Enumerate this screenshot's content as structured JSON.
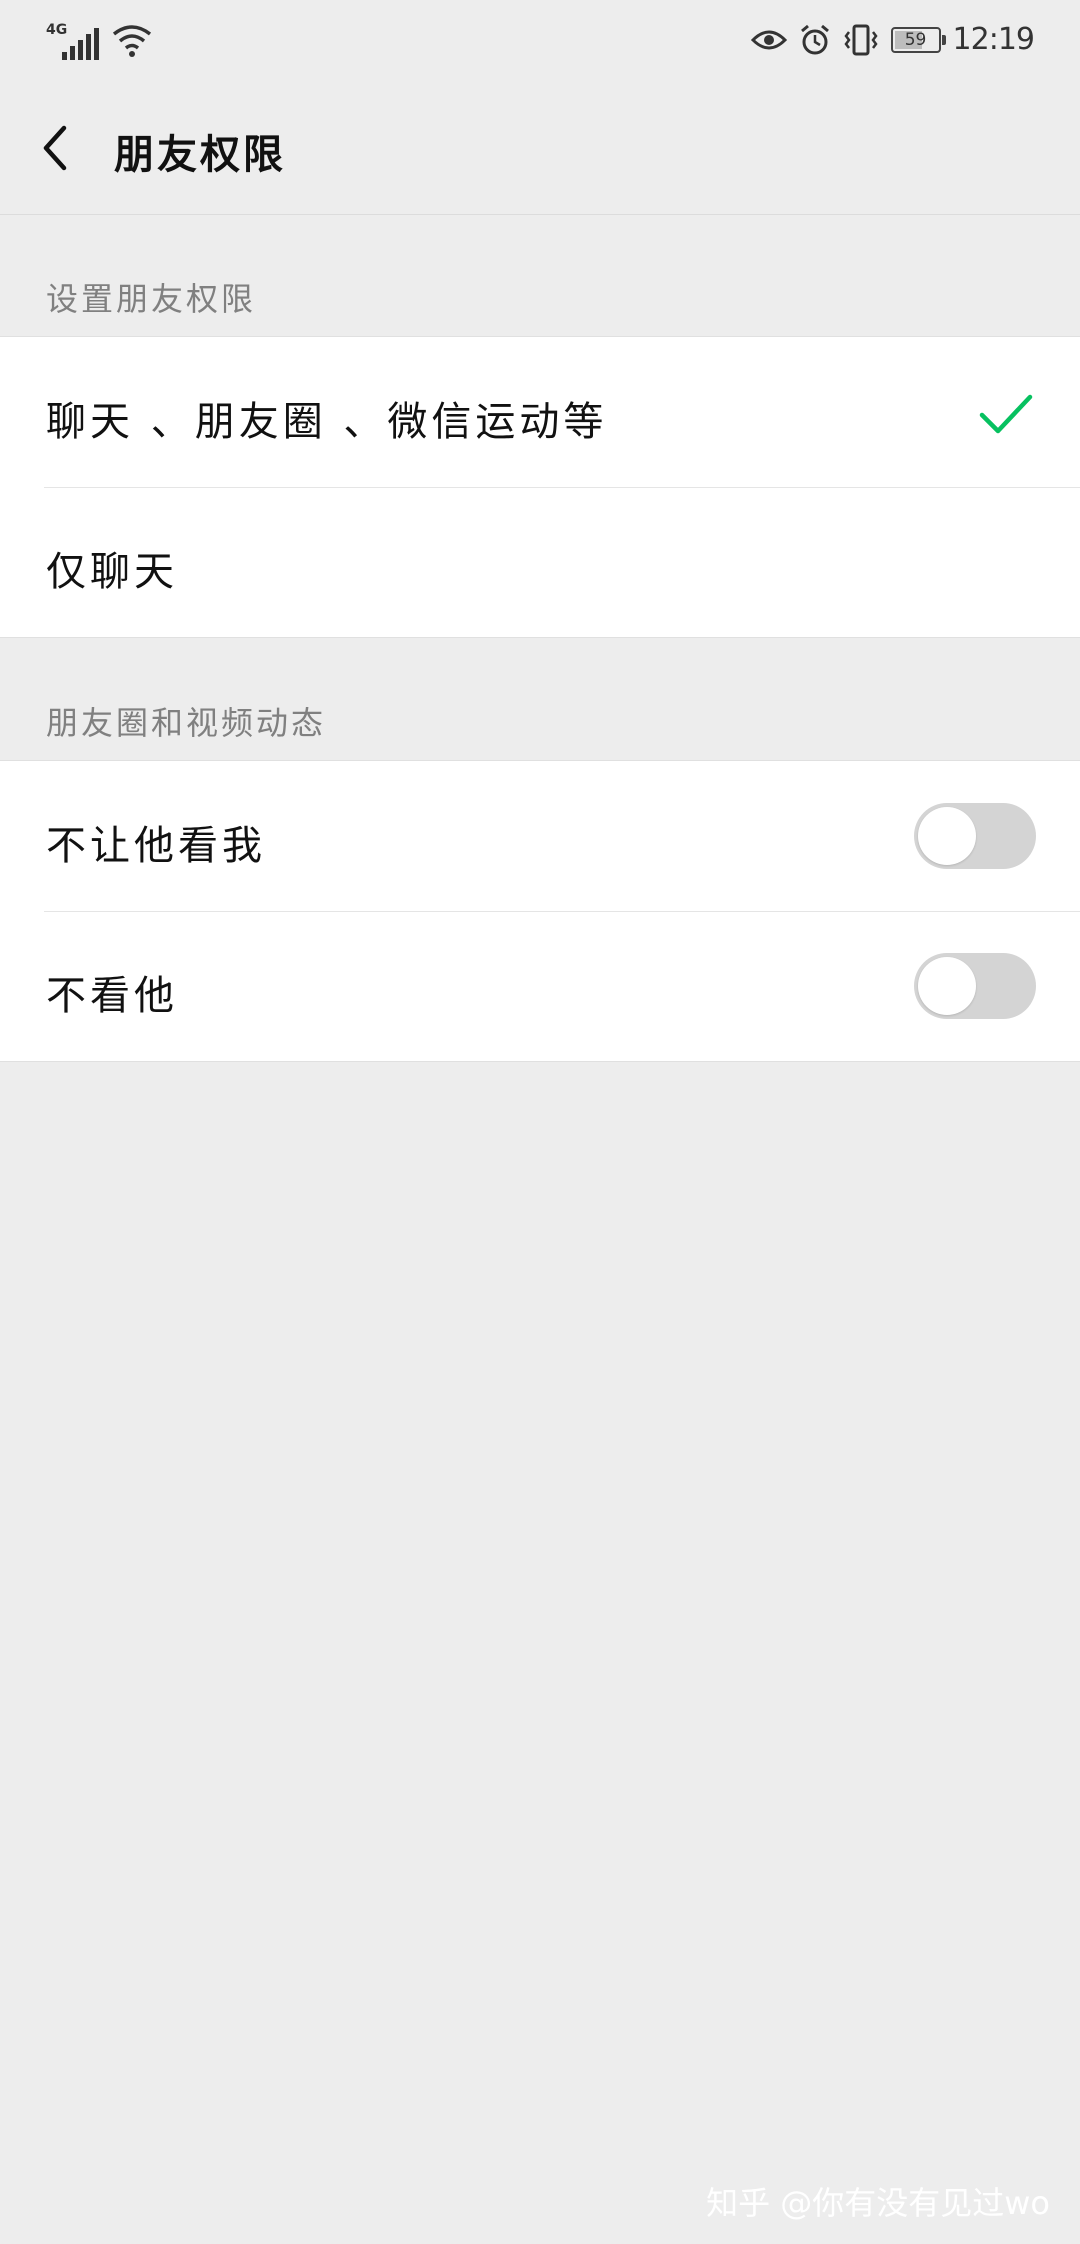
{
  "status_bar": {
    "network": "4G",
    "battery": "59",
    "time": "12:19",
    "icons": [
      "signal-icon",
      "wifi-icon",
      "eye-icon",
      "alarm-icon",
      "vibrate-icon",
      "battery-icon"
    ]
  },
  "header": {
    "title": "朋友权限",
    "back_icon": "chevron-left-icon"
  },
  "sections": [
    {
      "title": "设置朋友权限",
      "items": [
        {
          "label": "聊天 、朋友圈 、微信运动等",
          "checked": true
        },
        {
          "label": "仅聊天",
          "checked": false
        }
      ]
    },
    {
      "title": "朋友圈和视频动态",
      "items": [
        {
          "label": "不让他看我",
          "toggle": false
        },
        {
          "label": "不看他",
          "toggle": false
        }
      ]
    }
  ],
  "colors": {
    "accent": "#07c160",
    "background": "#ededed",
    "toggle_off": "#d4d4d4"
  },
  "watermark": "知乎 @你有没有见过wo"
}
